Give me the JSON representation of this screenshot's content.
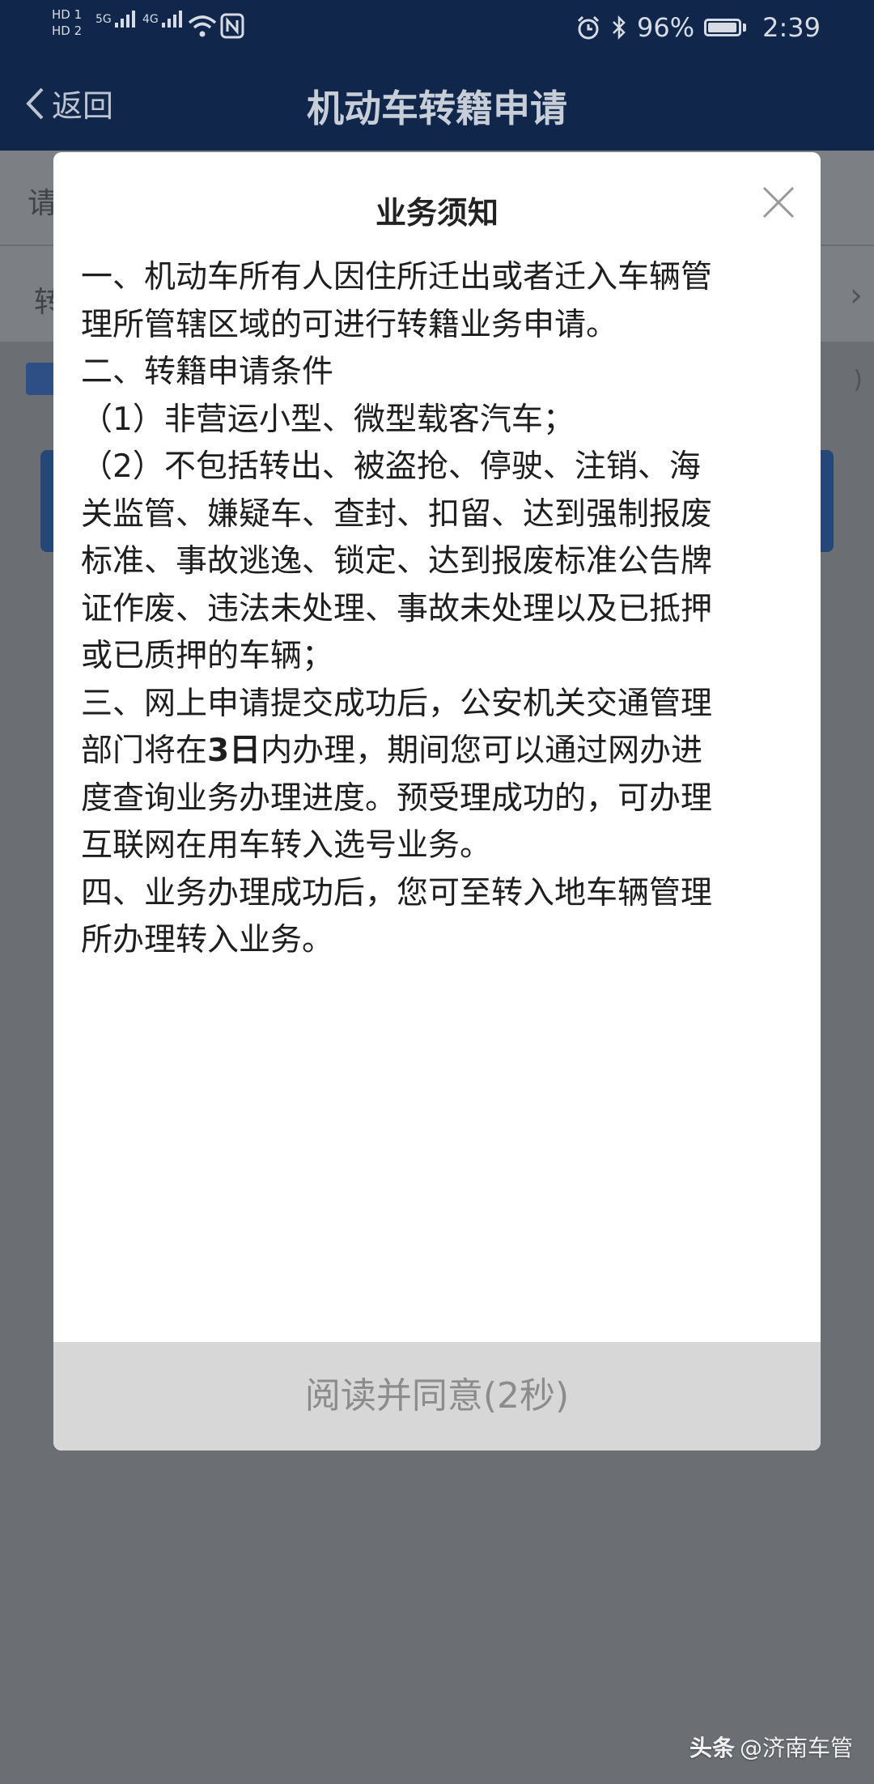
{
  "status_bar": {
    "sim_labels": [
      "HD 1",
      "HD 2"
    ],
    "network_1": "5G",
    "network_2": "4G",
    "battery": "96%",
    "time": "2:39"
  },
  "nav": {
    "back_label": "返回",
    "title": "机动车转籍申请"
  },
  "underlying": {
    "row1_text": "请",
    "row2_text": "转",
    "paren": ")"
  },
  "modal": {
    "title": "业务须知",
    "lines": [
      "一、机动车所有人因住所迁出或者迁入车辆管",
      "理所管辖区域的可进行转籍业务申请。",
      "二、转籍申请条件",
      "（1）非营运小型、微型载客汽车；",
      "（2）不包括转出、被盗抢、停驶、注销、海",
      "关监管、嫌疑车、查封、扣留、达到强制报废",
      "标准、事故逃逸、锁定、达到报废标准公告牌",
      "证作废、违法未处理、事故未处理以及已抵押",
      "或已质押的车辆；",
      "三、网上申请提交成功后，公安机关交通管理"
    ],
    "line11_before": "部门将在",
    "line11_bold": "3日",
    "line11_after": "内办理，期间您可以通过网办进",
    "lines_after": [
      "度查询业务办理进度。预受理成功的，可办理",
      "互联网在用车转入选号业务。",
      "四、业务办理成功后，您可至转入地车辆管理",
      "所办理转入业务。"
    ],
    "agree_button": "阅读并同意(2秒)"
  },
  "watermark": {
    "brand": "头条",
    "account": "@济南车管"
  }
}
